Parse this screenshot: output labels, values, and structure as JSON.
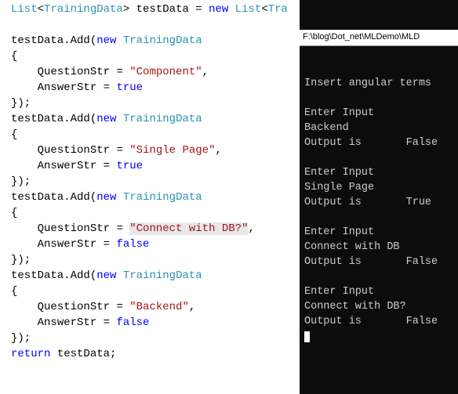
{
  "editor": {
    "lines": [
      {
        "indent": 0,
        "tokens": [
          [
            "type",
            "List"
          ],
          [
            "punc",
            "<"
          ],
          [
            "type",
            "TrainingData"
          ],
          [
            "punc",
            "> "
          ],
          [
            "ident",
            "testData "
          ],
          [
            "punc",
            "= "
          ],
          [
            "kw",
            "new "
          ],
          [
            "type",
            "List"
          ],
          [
            "punc",
            "<"
          ],
          [
            "type",
            "Tra"
          ]
        ]
      },
      {
        "indent": 0,
        "tokens": []
      },
      {
        "indent": 0,
        "tokens": [
          [
            "ident",
            "testData"
          ],
          [
            "punc",
            "."
          ],
          [
            "ident",
            "Add"
          ],
          [
            "punc",
            "("
          ],
          [
            "kw",
            "new "
          ],
          [
            "type",
            "TrainingData"
          ]
        ]
      },
      {
        "indent": 0,
        "tokens": [
          [
            "punc",
            "{"
          ]
        ]
      },
      {
        "indent": 1,
        "tokens": [
          [
            "ident",
            "QuestionStr "
          ],
          [
            "punc",
            "= "
          ],
          [
            "str",
            "\"Component\""
          ],
          [
            "punc",
            ","
          ]
        ]
      },
      {
        "indent": 1,
        "tokens": [
          [
            "ident",
            "AnswerStr "
          ],
          [
            "punc",
            "= "
          ],
          [
            "kw",
            "true"
          ]
        ]
      },
      {
        "indent": 0,
        "tokens": [
          [
            "punc",
            "});"
          ]
        ]
      },
      {
        "indent": 0,
        "tokens": [
          [
            "ident",
            "testData"
          ],
          [
            "punc",
            "."
          ],
          [
            "ident",
            "Add"
          ],
          [
            "punc",
            "("
          ],
          [
            "kw",
            "new "
          ],
          [
            "type",
            "TrainingData"
          ]
        ]
      },
      {
        "indent": 0,
        "tokens": [
          [
            "punc",
            "{"
          ]
        ]
      },
      {
        "indent": 1,
        "tokens": [
          [
            "ident",
            "QuestionStr "
          ],
          [
            "punc",
            "= "
          ],
          [
            "str",
            "\"Single Page\""
          ],
          [
            "punc",
            ","
          ]
        ]
      },
      {
        "indent": 1,
        "tokens": [
          [
            "ident",
            "AnswerStr "
          ],
          [
            "punc",
            "= "
          ],
          [
            "kw",
            "true"
          ]
        ]
      },
      {
        "indent": 0,
        "tokens": [
          [
            "punc",
            "});"
          ]
        ]
      },
      {
        "indent": 0,
        "tokens": [
          [
            "ident",
            "testData"
          ],
          [
            "punc",
            "."
          ],
          [
            "ident",
            "Add"
          ],
          [
            "punc",
            "("
          ],
          [
            "kw",
            "new "
          ],
          [
            "type",
            "TrainingData"
          ]
        ]
      },
      {
        "indent": 0,
        "tokens": [
          [
            "punc",
            "{"
          ]
        ]
      },
      {
        "indent": 1,
        "tokens": [
          [
            "ident",
            "QuestionStr "
          ],
          [
            "punc",
            "= "
          ],
          [
            "hstr",
            "\"Connect with DB?\""
          ],
          [
            "punc",
            ","
          ]
        ]
      },
      {
        "indent": 1,
        "tokens": [
          [
            "ident",
            "AnswerStr "
          ],
          [
            "punc",
            "= "
          ],
          [
            "kw",
            "false"
          ]
        ]
      },
      {
        "indent": 0,
        "tokens": [
          [
            "punc",
            "});"
          ]
        ]
      },
      {
        "indent": 0,
        "tokens": [
          [
            "ident",
            "testData"
          ],
          [
            "punc",
            "."
          ],
          [
            "ident",
            "Add"
          ],
          [
            "punc",
            "("
          ],
          [
            "kw",
            "new "
          ],
          [
            "type",
            "TrainingData"
          ]
        ]
      },
      {
        "indent": 0,
        "tokens": [
          [
            "punc",
            "{"
          ]
        ]
      },
      {
        "indent": 1,
        "tokens": [
          [
            "ident",
            "QuestionStr "
          ],
          [
            "punc",
            "= "
          ],
          [
            "str",
            "\"Backend\""
          ],
          [
            "punc",
            ","
          ]
        ]
      },
      {
        "indent": 1,
        "tokens": [
          [
            "ident",
            "AnswerStr "
          ],
          [
            "punc",
            "= "
          ],
          [
            "kw",
            "false"
          ]
        ]
      },
      {
        "indent": 0,
        "tokens": [
          [
            "punc",
            "});"
          ]
        ]
      },
      {
        "indent": 0,
        "tokens": [
          [
            "kw",
            "return "
          ],
          [
            "ident",
            "testData"
          ],
          [
            "punc",
            ";"
          ]
        ]
      }
    ]
  },
  "terminal": {
    "titlebar": "F:\\blog\\Dot_net\\MLDemo\\MLD",
    "lines": [
      "Insert angular terms",
      "",
      "Enter Input",
      "Backend",
      "Output is       False",
      "",
      "Enter Input",
      "Single Page",
      "Output is       True",
      "",
      "Enter Input",
      "Connect with DB",
      "Output is       False",
      "",
      "Enter Input",
      "Connect with DB?",
      "Output is       False"
    ]
  }
}
